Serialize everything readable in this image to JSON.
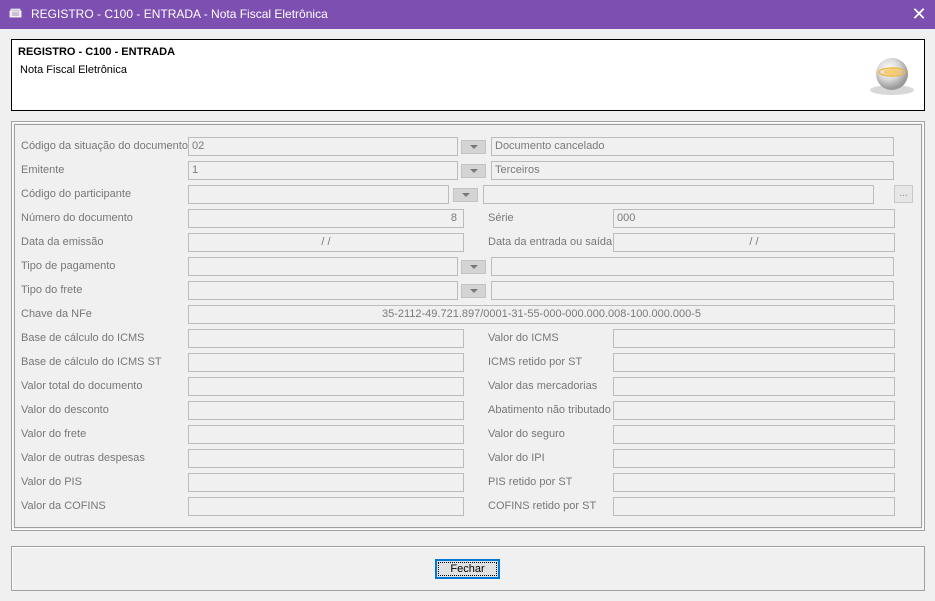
{
  "window": {
    "title": "REGISTRO - C100 - ENTRADA - Nota Fiscal Eletrônica",
    "close_glyph": "✕",
    "icon": "app-books-icon"
  },
  "header": {
    "title": "REGISTRO - C100 - ENTRADA",
    "subtitle": "Nota Fiscal Eletrônica",
    "logo_icon": "sped-globe-logo"
  },
  "form": {
    "situacao": {
      "label": "Código da situação do documento",
      "code": "02",
      "description": "Documento cancelado"
    },
    "emitente": {
      "label": "Emitente",
      "code": "1",
      "description": "Terceiros"
    },
    "participante": {
      "label": "Código do participante",
      "code": "",
      "description": "",
      "lookup_label": "..."
    },
    "numero": {
      "label": "Número do documento",
      "value": "8"
    },
    "serie": {
      "label": "Série",
      "value": "000"
    },
    "data_emissao": {
      "label": "Data da emissão",
      "value": "/ /"
    },
    "data_entrada": {
      "label": "Data da entrada ou saída",
      "value": "/ /"
    },
    "tipo_pagamento": {
      "label": "Tipo de pagamento",
      "code": "",
      "description": ""
    },
    "tipo_frete": {
      "label": "Tipo do frete",
      "code": "",
      "description": ""
    },
    "chave_nfe": {
      "label": "Chave da NFe",
      "value": "35-2112-49.721.897/0001-31-55-000-000.000.008-100.000.000-5"
    },
    "left_amounts": [
      {
        "label": "Base de cálculo do ICMS",
        "value": ""
      },
      {
        "label": "Base de cálculo do ICMS ST",
        "value": ""
      },
      {
        "label": "Valor total do documento",
        "value": ""
      },
      {
        "label": "Valor do desconto",
        "value": ""
      },
      {
        "label": "Valor do frete",
        "value": ""
      },
      {
        "label": "Valor de outras despesas",
        "value": ""
      },
      {
        "label": "Valor do PIS",
        "value": ""
      },
      {
        "label": "Valor da COFINS",
        "value": ""
      }
    ],
    "right_amounts": [
      {
        "label": "Valor do ICMS",
        "value": ""
      },
      {
        "label": "ICMS retido por ST",
        "value": ""
      },
      {
        "label": "Valor das mercadorias",
        "value": ""
      },
      {
        "label": "Abatimento não tributado",
        "value": ""
      },
      {
        "label": "Valor do seguro",
        "value": ""
      },
      {
        "label": "Valor do IPI",
        "value": ""
      },
      {
        "label": "PIS retido por ST",
        "value": ""
      },
      {
        "label": "COFINS retido por ST",
        "value": ""
      }
    ]
  },
  "footer": {
    "close_button_label": "Fechar"
  }
}
